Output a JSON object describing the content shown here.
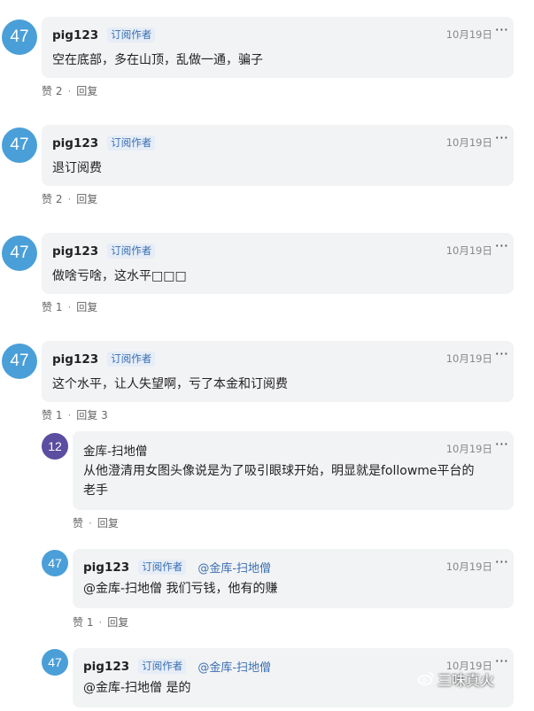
{
  "colors": {
    "avatar_blue": "#4a9fd8",
    "avatar_purple": "#5b4da0",
    "tag_blue": "#3a6fb0",
    "bubble": "#f2f3f5"
  },
  "comments": [
    {
      "avatar": "47",
      "author": "pig123",
      "tag": "订阅作者",
      "date": "10月19日",
      "content": "空在底部，多在山顶，乱做一通，骗子",
      "like": "赞 2",
      "reply": "回复"
    },
    {
      "avatar": "47",
      "author": "pig123",
      "tag": "订阅作者",
      "date": "10月19日",
      "content": "退订阅费",
      "like": "赞 2",
      "reply": "回复"
    },
    {
      "avatar": "47",
      "author": "pig123",
      "tag": "订阅作者",
      "date": "10月19日",
      "content": "做啥亏啥，这水平□□□",
      "like": "赞 1",
      "reply": "回复"
    },
    {
      "avatar": "47",
      "author": "pig123",
      "tag": "订阅作者",
      "date": "10月19日",
      "content": "这个水平，让人失望啊，亏了本金和订阅费",
      "like": "赞 1",
      "reply": "回复 3"
    }
  ],
  "replies": [
    {
      "avatar": "12",
      "author": "金库-扫地僧",
      "date": "10月19日",
      "content_line1": "从他澄清用女图头像说是为了吸引眼球开始，明显就是followme平台的",
      "content_line2": "老手",
      "like": "赞",
      "reply": "回复"
    },
    {
      "avatar": "47",
      "author": "pig123",
      "tag": "订阅作者",
      "mention": "@金库-扫地僧",
      "date": "10月19日",
      "content": "@金库-扫地僧 我们亏钱，他有的赚",
      "like": "赞 1",
      "reply": "回复"
    },
    {
      "avatar": "47",
      "author": "pig123",
      "tag": "订阅作者",
      "mention": "@金库-扫地僧",
      "date": "10月19日",
      "content": "@金库-扫地僧 是的"
    }
  ],
  "more_icon": "···",
  "watermark": "三味真火",
  "watermark_icon": "weibo-like-icon"
}
